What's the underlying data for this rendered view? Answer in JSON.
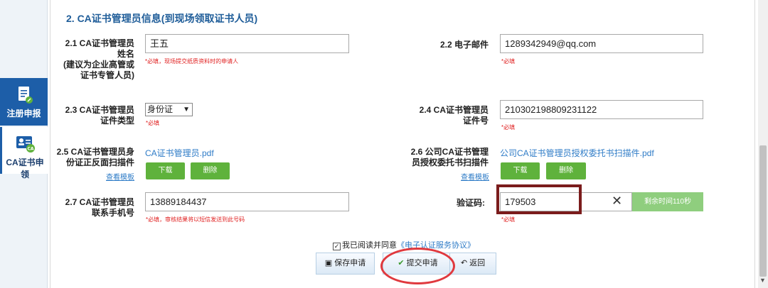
{
  "sidebar": {
    "items": [
      {
        "label": "注册申报"
      },
      {
        "label": "CA证书申领"
      }
    ]
  },
  "section": {
    "title": "2. CA证书管理员信息(到现场领取证书人员)"
  },
  "fields": {
    "name": {
      "label": "2.1 CA证书管理员姓名(建议为企业高管或证书专管人员)",
      "label_lines": [
        "2.1 CA证书管理员",
        "姓名",
        "(建议为企业高管或",
        "证书专管人员)"
      ],
      "value": "王五",
      "hint": "*必填，现场提交纸质资料时的申请人"
    },
    "email": {
      "label": "2.2 电子邮件",
      "value": "1289342949@qq.com",
      "hint": "*必填"
    },
    "id_type": {
      "label_lines": [
        "2.3 CA证书管理员",
        "证件类型"
      ],
      "value": "身份证",
      "hint": "*必填"
    },
    "id_number": {
      "label_lines": [
        "2.4 CA证书管理员",
        "证件号"
      ],
      "value": "210302198809231122",
      "hint": "*必填"
    },
    "id_scan": {
      "label_lines": [
        "2.5 CA证书管理员身",
        "份证正反面扫描件"
      ],
      "file": "CA证书管理员.pdf",
      "template_link": "查看模板",
      "download": "下载",
      "delete": "删除"
    },
    "auth_scan": {
      "label_lines": [
        "2.6 公司CA证书管理",
        "员授权委托书扫描件"
      ],
      "file": "公司CA证书管理员授权委托书扫描件.pdf",
      "template_link": "查看模板",
      "download": "下载",
      "delete": "删除"
    },
    "phone": {
      "label_lines": [
        "2.7 CA证书管理员",
        "联系手机号"
      ],
      "value": "13889184437",
      "hint": "*必填，审核结果将以短信发送到此号码"
    },
    "captcha": {
      "label": "验证码:",
      "value": "179503",
      "hint": "*必填",
      "timer": "剩余时间110秒"
    }
  },
  "agreement": {
    "prefix": "我已阅读并同意",
    "link": "《电子认证服务协议》"
  },
  "actions": {
    "save": "保存申请",
    "submit": "提交申请",
    "back": "返回"
  },
  "colors": {
    "accent": "#1d5ea8",
    "link": "#2f7cc7",
    "green": "#5fb23c",
    "required": "#e02020",
    "highlight_rect": "#7b1c1c",
    "highlight_oval": "#e0393e"
  }
}
